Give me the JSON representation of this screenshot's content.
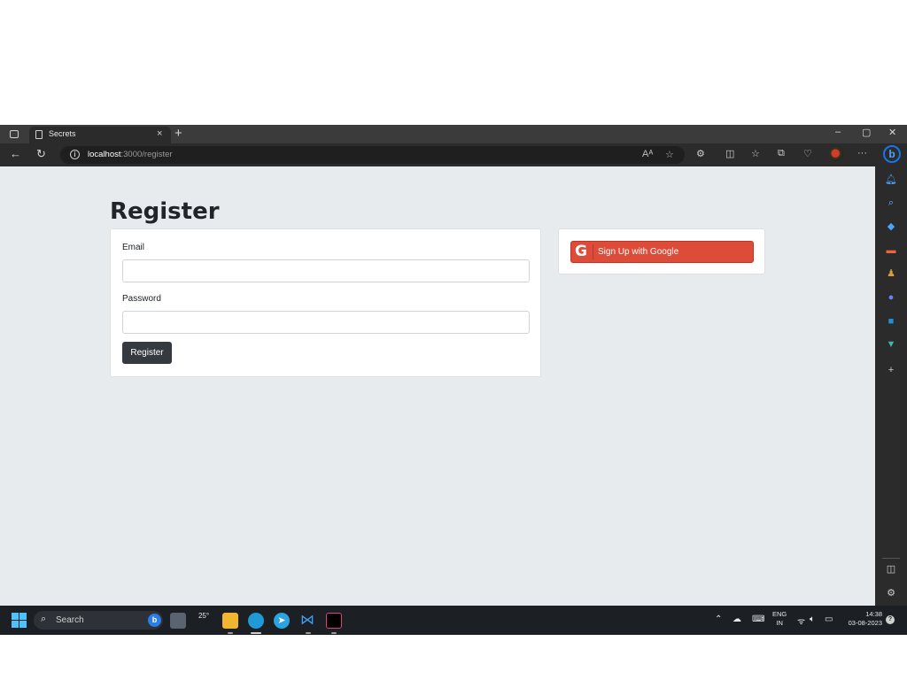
{
  "browser": {
    "tab_title": "Secrets",
    "tab_close": "×",
    "new_tab": "+",
    "window_controls": {
      "minimize": "–",
      "maximize": "▢",
      "close": "✕"
    },
    "url_host": "localhost",
    "url_path": ":3000/register",
    "more_label": "···"
  },
  "page": {
    "title": "Register",
    "form": {
      "email_label": "Email",
      "email_value": "",
      "password_label": "Password",
      "password_value": "",
      "submit_label": "Register"
    },
    "social": {
      "google_label": "Sign Up with Google",
      "google_color": "#dd4b39"
    }
  },
  "taskbar": {
    "search_placeholder": "Search",
    "weather_temp": "25°",
    "lang_primary": "ENG",
    "lang_secondary": "IN",
    "time": "14:38",
    "date": "03-08-2023"
  },
  "icons": {
    "browser": [
      "tab-actions-icon",
      "page-icon",
      "back-icon",
      "refresh-icon",
      "info-icon",
      "read-aloud-icon",
      "favorite-star-icon",
      "extensions-icon",
      "split-screen-icon",
      "favorites-icon",
      "collections-icon",
      "performance-icon",
      "profile-icon",
      "more-icon",
      "bing-icon"
    ],
    "sidebar": [
      "bell-icon",
      "search-icon",
      "tag-icon",
      "toolbox-icon",
      "games-icon",
      "office-icon",
      "outlook-icon",
      "drop-icon",
      "add-icon",
      "sidebar-toggle-icon",
      "settings-icon"
    ]
  }
}
